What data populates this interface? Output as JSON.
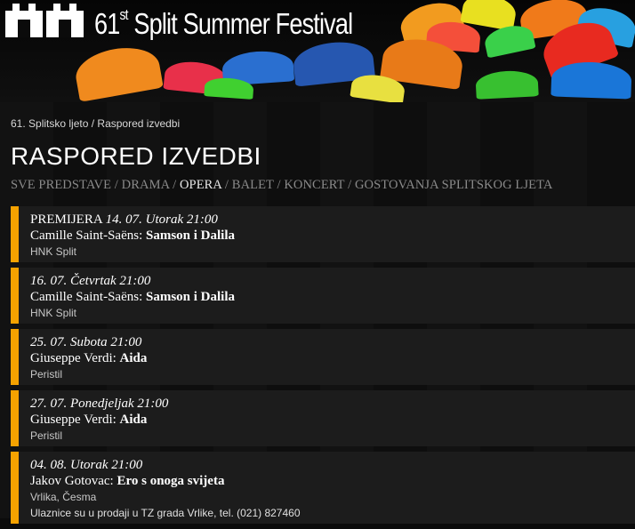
{
  "header": {
    "festival_title_number": "61",
    "festival_title_suffix": "st",
    "festival_title_rest": " Split Summer Festival"
  },
  "breadcrumb": {
    "home": "61. Splitsko ljeto",
    "separator": " / ",
    "current": "Raspored izvedbi"
  },
  "page": {
    "heading": "RASPORED IZVEDBI"
  },
  "filters": [
    {
      "label": "SVE PREDSTAVE",
      "active": false
    },
    {
      "label": "DRAMA",
      "active": false
    },
    {
      "label": "OPERA",
      "active": true
    },
    {
      "label": "BALET",
      "active": false
    },
    {
      "label": "KONCERT",
      "active": false
    },
    {
      "label": "GOSTOVANJA SPLITSKOG LJETA",
      "active": false
    }
  ],
  "filter_separator": " / ",
  "events": [
    {
      "premiere": "PREMIJERA ",
      "date": "14. 07. Utorak 21:00",
      "composer": "Camille Saint-Saëns:",
      "title": "Samson i Dalila",
      "venue": "HNK Split",
      "note": ""
    },
    {
      "premiere": "",
      "date": "16. 07. Četvrtak 21:00",
      "composer": "Camille Saint-Saëns:",
      "title": "Samson i Dalila",
      "venue": "HNK Split",
      "note": ""
    },
    {
      "premiere": "",
      "date": "25. 07. Subota 21:00",
      "composer": "Giuseppe Verdi: ",
      "title": "Aida",
      "venue": "Peristil",
      "note": ""
    },
    {
      "premiere": "",
      "date": "27. 07. Ponedjeljak 21:00",
      "composer": "Giuseppe Verdi: ",
      "title": "Aida",
      "venue": "Peristil",
      "note": ""
    },
    {
      "premiere": "",
      "date": "04. 08. Utorak 21:00",
      "composer": "Jakov Gotovac:",
      "title": "Ero s onoga svijeta",
      "venue": "Vrlika, Česma",
      "note": "Ulaznice su u prodaji u TZ grada Vrlike, tel. (021) 827460"
    }
  ],
  "colors": {
    "accent": "#f5a200",
    "card_bg": "#1c1c1c"
  }
}
